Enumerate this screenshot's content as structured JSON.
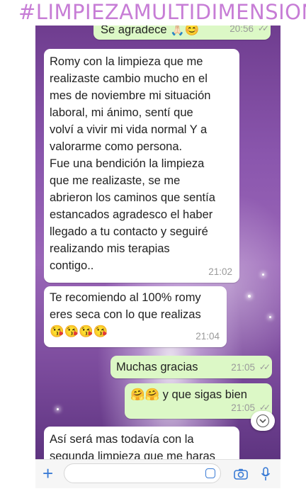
{
  "header": {
    "hashtag": "#LIMPIEZAMULTIDIMENSIONAL"
  },
  "messages": [
    {
      "side": "out",
      "text": "Se agradece 🙏🏻😊",
      "time": "20:56"
    },
    {
      "side": "in",
      "text": "Romy con la limpieza que me\nrealizaste cambio mucho en el\nmes de noviembre mi situación\nlaboral, mi ánimo, sentí que\nvolví a vivir mi vida normal Y a\nvalorarme como persona.\nFue una bendición la limpieza\nque me realizaste, se me\nabrieron los caminos que sentía\nestancados agradesco el haber\nllegado a tu contacto y seguiré\nrealizando mis terapias\ncontigo..",
      "time": "21:02"
    },
    {
      "side": "in",
      "text": "Te recomiendo al 100% romy\neres seca con lo que realizas\n😘😘😘😘",
      "time": "21:04"
    },
    {
      "side": "out",
      "text": "Muchas gracias",
      "time": "21:05"
    },
    {
      "side": "out",
      "text": "🤗🤗 y que sigas bien",
      "time": "21:05"
    },
    {
      "side": "in",
      "text": "Así será mas todavía con la\nsegunda limpieza que me haras",
      "time": ""
    }
  ],
  "icons": {
    "scroll": "chevron-down-icon",
    "attach": "plus-icon",
    "sticker": "sticker-icon",
    "camera": "camera-icon",
    "mic": "microphone-icon"
  },
  "colors": {
    "incoming": "#ffffff",
    "outgoing": "#dcf8c6",
    "accent": "#3a7bd5",
    "hashtag": "#c77dd6"
  }
}
